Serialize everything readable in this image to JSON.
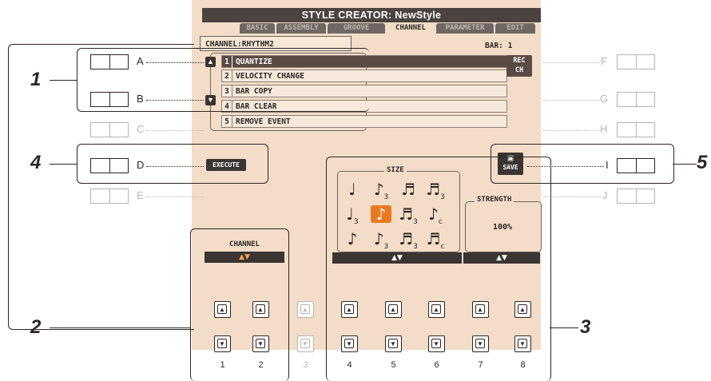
{
  "screen": {
    "title": "STYLE CREATOR: NewStyle",
    "tabs": [
      "BASIC",
      "ASSEMBLY",
      "GROOVE",
      "CHANNEL",
      "PARAMETER",
      "EDIT"
    ],
    "active_tab": "CHANNEL",
    "channel_label": "CHANNEL:RHYTHM2",
    "bar_label": "BAR:  1",
    "menu": [
      {
        "num": "1",
        "label": "QUANTIZE"
      },
      {
        "num": "2",
        "label": "VELOCITY CHANGE"
      },
      {
        "num": "3",
        "label": "BAR COPY"
      },
      {
        "num": "4",
        "label": "BAR CLEAR"
      },
      {
        "num": "5",
        "label": "REMOVE EVENT"
      }
    ],
    "selected_menu": "1",
    "rec_ch_line1": "REC",
    "rec_ch_line2": "CH",
    "execute_label": "EXECUTE",
    "save_label": "SAVE",
    "size_title": "SIZE",
    "strength_title": "STRENGTH",
    "strength_value": "100%",
    "channel_section_label": "CHANNEL",
    "arrows": "▲▼"
  },
  "side_buttons": {
    "left": [
      "A",
      "B",
      "C",
      "D",
      "E"
    ],
    "right": [
      "F",
      "G",
      "H",
      "I",
      "J"
    ]
  },
  "bottom_numbers": [
    "1",
    "2",
    "3",
    "4",
    "5",
    "6",
    "7",
    "8"
  ],
  "callouts": [
    "1",
    "2",
    "3",
    "4",
    "5"
  ],
  "colors": {
    "accent": "#e8791f",
    "lcd": "#f3ddc8",
    "dark": "#3a3432"
  }
}
